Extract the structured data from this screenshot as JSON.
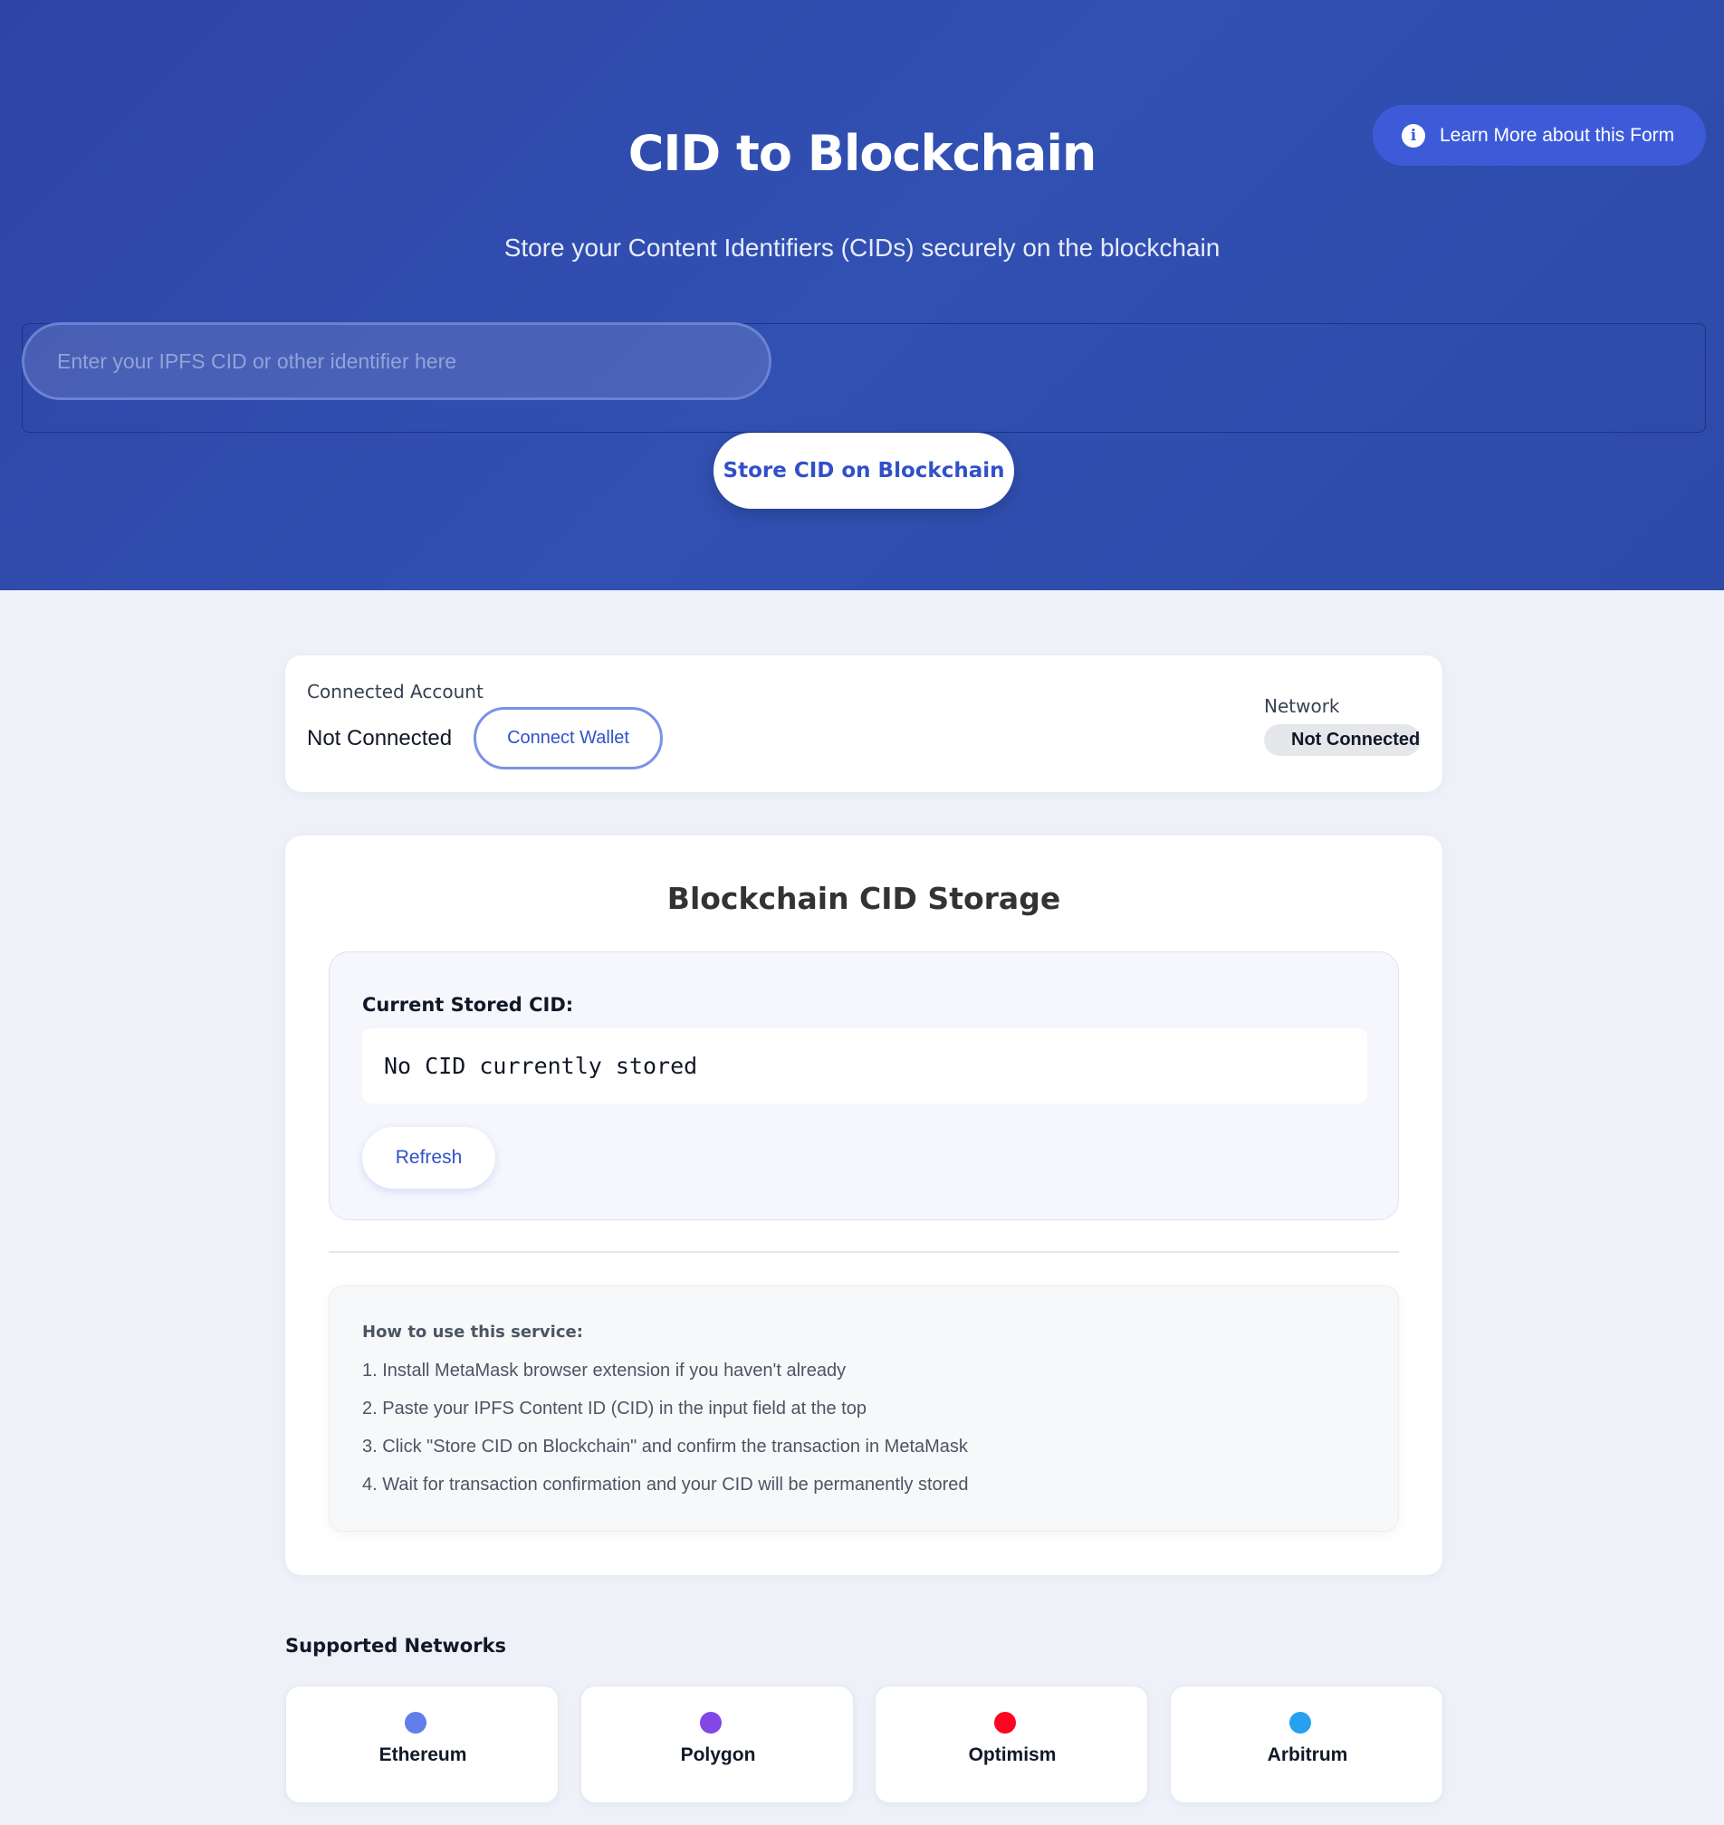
{
  "hero": {
    "title": "CID to Blockchain",
    "subtitle": "Store your Content Identifiers (CIDs) securely on the blockchain",
    "learn_more_label": "Learn More about this Form",
    "info_glyph": "i",
    "input_placeholder": "Enter your IPFS CID or other identifier here",
    "input_value": "",
    "store_button_label": "Store CID on Blockchain"
  },
  "account": {
    "connected_label": "Connected Account",
    "connected_value": "Not Connected",
    "connect_button_label": "Connect Wallet",
    "network_label": "Network",
    "network_value": "Not Connected"
  },
  "storage": {
    "title": "Blockchain CID Storage",
    "current_label": "Current Stored CID:",
    "current_value": "No CID currently stored",
    "refresh_label": "Refresh",
    "howto_title": "How to use this service:",
    "steps": [
      "1. Install MetaMask browser extension if you haven't already",
      "2. Paste your IPFS Content ID (CID) in the input field at the top",
      "3. Click \"Store CID on Blockchain\" and confirm the transaction in MetaMask",
      "4. Wait for transaction confirmation and your CID will be permanently stored"
    ]
  },
  "networks": {
    "title": "Supported Networks",
    "items": [
      {
        "name": "Ethereum",
        "color": "#627eea"
      },
      {
        "name": "Polygon",
        "color": "#8247e5"
      },
      {
        "name": "Optimism",
        "color": "#ff0420"
      },
      {
        "name": "Arbitrum",
        "color": "#28a0f0"
      }
    ]
  },
  "colors": {
    "hero_bg": "#3150b2",
    "accent": "#3152c7",
    "page_bg": "#eef1f8"
  },
  "icons": {
    "learn_more": "info-icon",
    "network_marker": "network-dot-icon"
  }
}
